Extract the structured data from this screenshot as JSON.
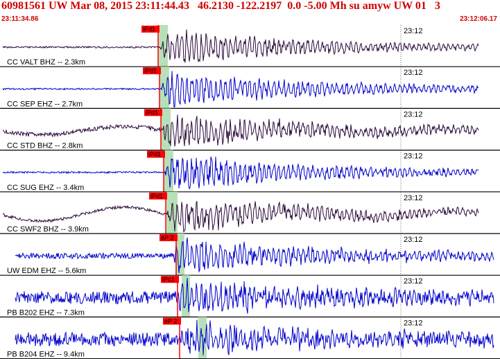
{
  "header": {
    "title": "60981561 UW Mar 08, 2015 23:11:44.43   46.2130 -122.2197  0.0 -5.00 Mh su amyw UW 01   3",
    "time_start": "23:11:34.86",
    "time_end": "23:12:06.17"
  },
  "colors": {
    "header_text": "#d00000",
    "pick_box": "#ff0000",
    "pick_line": "#ff0000",
    "window_shade": "#b8e0b8",
    "trace_dark": "#2a0a3a",
    "trace_blue": "#0000cc",
    "divider": "#000000"
  },
  "traces": [
    {
      "label": "CC VALT BHZ -- 2.3km",
      "pick": "iPd1",
      "time_mark": "23:12",
      "color": "dark",
      "amp": 24,
      "noise": 1.2,
      "lowfreq": 0,
      "onset": 231
    },
    {
      "label": "CC SEP EHZ -- 2.7km",
      "pick": "iPd1",
      "time_mark": "23:12",
      "color": "blue",
      "amp": 26,
      "noise": 1.2,
      "lowfreq": 0,
      "onset": 233
    },
    {
      "label": "CC STD BHZ -- 2.8km",
      "pick": "iPd1",
      "time_mark": "23:12",
      "color": "dark",
      "amp": 24,
      "noise": 3,
      "lowfreq": 6,
      "onset": 234
    },
    {
      "label": "CC SUG EHZ -- 3.4km",
      "pick": "iPd1",
      "time_mark": "23:12",
      "color": "blue",
      "amp": 27,
      "noise": 1.2,
      "lowfreq": 0,
      "onset": 238
    },
    {
      "label": "CC SWF2 BHZ -- 3.9km",
      "pick": "iPd1",
      "time_mark": "23:12",
      "color": "dark",
      "amp": 26,
      "noise": 2,
      "lowfreq": 10,
      "onset": 240
    },
    {
      "label": "UW EDM EHZ -- 5.6km",
      "pick": "eP 2",
      "time_mark": "23:12",
      "color": "blue",
      "amp": 24,
      "noise": 4,
      "lowfreq": 0,
      "onset": 250
    },
    {
      "label": "PB B202 EHZ -- 7.3km",
      "pick": "iPc1",
      "time_mark": "23:12",
      "color": "blue",
      "amp": 22,
      "noise": 9,
      "lowfreq": 0,
      "onset": 256
    },
    {
      "label": "PB B204 EHZ -- 9.4km",
      "pick": "eP 2",
      "time_mark": "23:12",
      "color": "blue",
      "amp": 20,
      "noise": 10,
      "lowfreq": 0,
      "onset": 260
    }
  ]
}
